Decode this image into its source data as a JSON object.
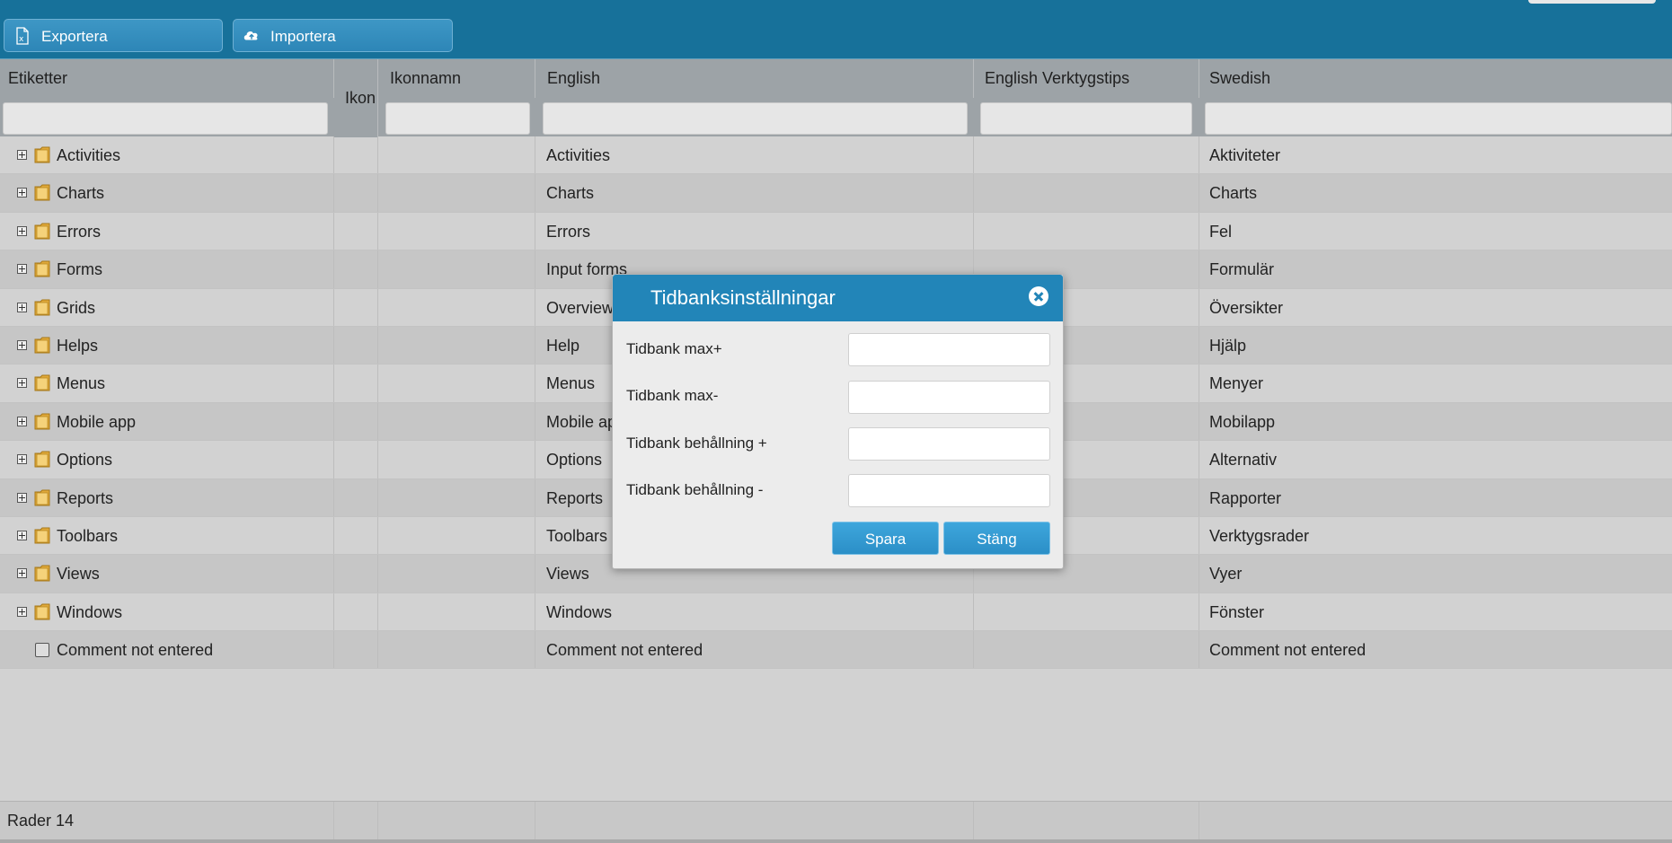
{
  "toolbar": {
    "export_label": "Exportera",
    "export_icon": "excel-icon",
    "import_label": "Importera",
    "import_icon": "cloud-upload-icon"
  },
  "grid": {
    "columns": {
      "labels": "Etiketter",
      "icon": "Ikon",
      "icon_name": "Ikonnamn",
      "english": "English",
      "english_tooltip": "English Verktygstips",
      "swedish": "Swedish"
    },
    "rows": [
      {
        "label": "Activities",
        "english": "Activities",
        "swedish": "Aktiviteter"
      },
      {
        "label": "Charts",
        "english": "Charts",
        "swedish": "Charts"
      },
      {
        "label": "Errors",
        "english": "Errors",
        "swedish": "Fel"
      },
      {
        "label": "Forms",
        "english": "Input forms",
        "swedish": "Formulär"
      },
      {
        "label": "Grids",
        "english": "Overviews",
        "swedish": "Översikter"
      },
      {
        "label": "Helps",
        "english": "Help",
        "swedish": "Hjälp"
      },
      {
        "label": "Menus",
        "english": "Menus",
        "swedish": "Menyer"
      },
      {
        "label": "Mobile app",
        "english": "Mobile app",
        "swedish": "Mobilapp"
      },
      {
        "label": "Options",
        "english": "Options",
        "swedish": "Alternativ"
      },
      {
        "label": "Reports",
        "english": "Reports",
        "swedish": "Rapporter"
      },
      {
        "label": "Toolbars",
        "english": "Toolbars",
        "swedish": "Verktygsrader"
      },
      {
        "label": "Views",
        "english": "Views",
        "swedish": "Vyer"
      },
      {
        "label": "Windows",
        "english": "Windows",
        "swedish": "Fönster"
      },
      {
        "label": "Comment not entered",
        "english": "Comment not entered",
        "swedish": "Comment not entered"
      }
    ],
    "footer": "Rader 14"
  },
  "dialog": {
    "title": "Tidbanksinställningar",
    "fields": [
      {
        "label": "Tidbank max+",
        "value": ""
      },
      {
        "label": "Tidbank max-",
        "value": ""
      },
      {
        "label": "Tidbank behållning +",
        "value": ""
      },
      {
        "label": "Tidbank behållning -",
        "value": ""
      }
    ],
    "save_label": "Spara",
    "close_label": "Stäng"
  },
  "colors": {
    "toolbar_bg": "#17719a",
    "dialog_header": "#2285b8",
    "button": "#2b8fc7",
    "folder": "#e0a93a"
  }
}
